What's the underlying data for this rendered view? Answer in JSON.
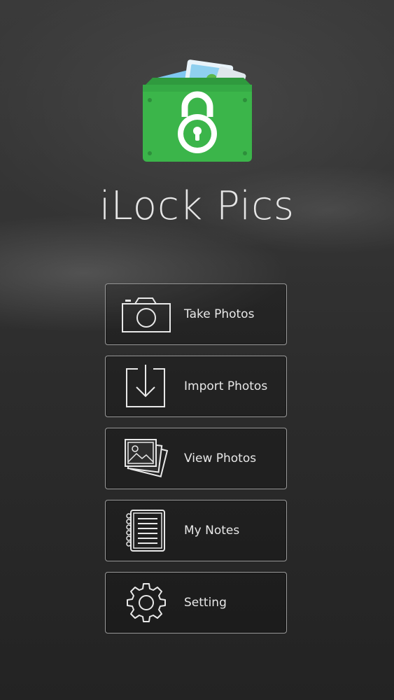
{
  "app": {
    "title": "iLock Pics"
  },
  "menu": {
    "items": [
      {
        "label": "Take Photos",
        "icon": "camera-icon"
      },
      {
        "label": "Import Photos",
        "icon": "import-icon"
      },
      {
        "label": "View Photos",
        "icon": "photos-icon"
      },
      {
        "label": "My Notes",
        "icon": "notebook-icon"
      },
      {
        "label": "Setting",
        "icon": "gear-icon"
      }
    ]
  },
  "colors": {
    "logo_green": "#3bb54a",
    "border": "#9a9a9a",
    "text": "#e8e8e8"
  }
}
